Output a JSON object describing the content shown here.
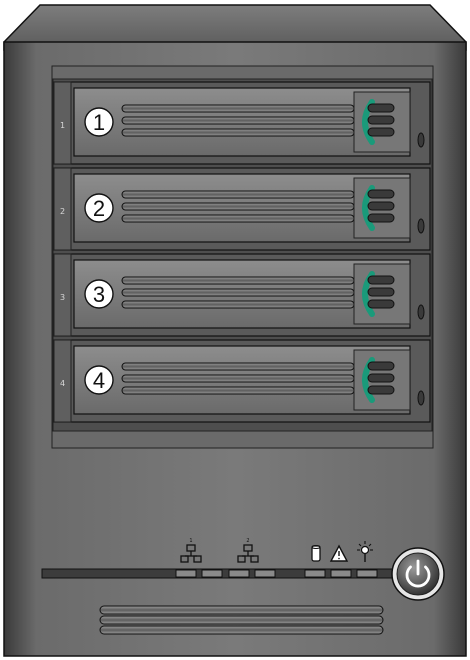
{
  "device": {
    "name": "",
    "colors": {
      "body": "#6e6e6e",
      "body_dark": "#3c3c3c",
      "bay_frame": "#5c5c5c",
      "tray": "#7b7b7b",
      "latch_green": "#1a9a7a",
      "led": "#8a8a8a",
      "outline": "#111111"
    },
    "bays": [
      {
        "side_label": "1",
        "circle_label": "1"
      },
      {
        "side_label": "2",
        "circle_label": "2"
      },
      {
        "side_label": "3",
        "circle_label": "3"
      },
      {
        "side_label": "4",
        "circle_label": "4"
      }
    ],
    "status_icons": [
      {
        "icon": "network-icon-1",
        "superscript": "1"
      },
      {
        "icon": "network-icon-2",
        "superscript": "2"
      },
      {
        "icon": "disk-activity-icon"
      },
      {
        "icon": "warning-icon"
      },
      {
        "icon": "system-light-icon"
      }
    ],
    "power_button": {
      "icon": "power-icon"
    }
  }
}
